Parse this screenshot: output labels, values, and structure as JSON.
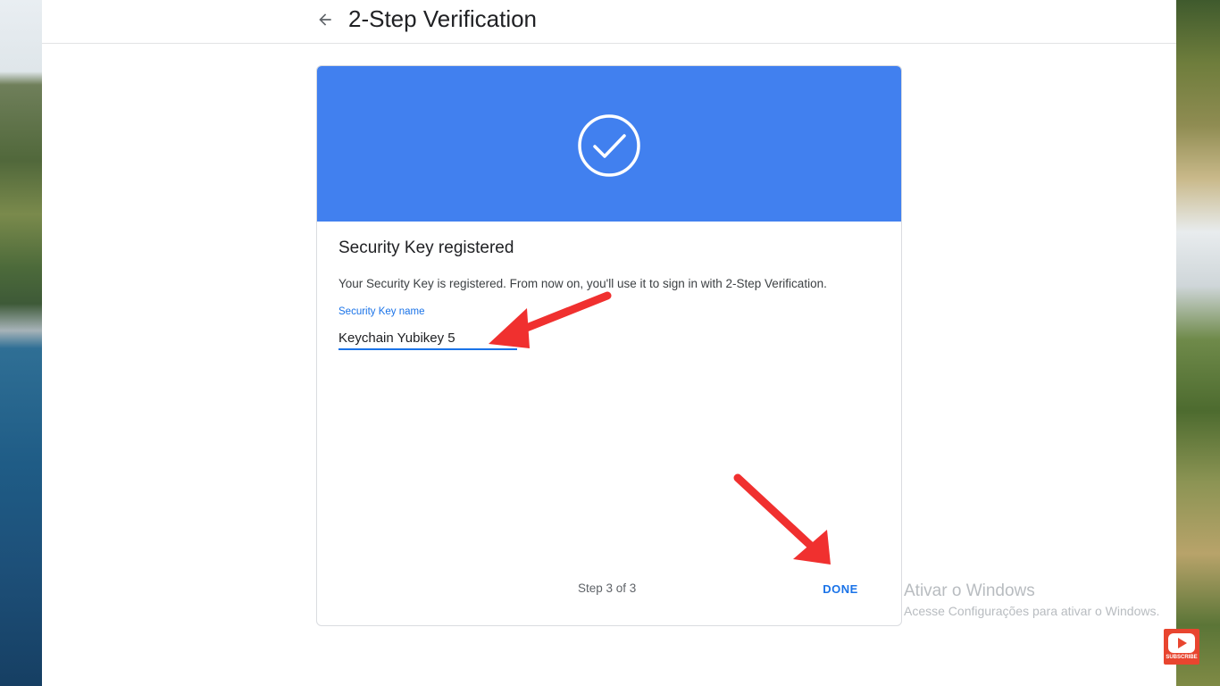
{
  "header": {
    "title": "2-Step Verification",
    "back_icon": "arrow-left-icon"
  },
  "card": {
    "hero_color": "#4180ef",
    "hero_icon": "check-circle-icon",
    "heading": "Security Key registered",
    "description": "Your Security Key is registered. From now on, you'll use it to sign in with 2-Step Verification.",
    "field_label": "Security Key name",
    "field_value": "Keychain Yubikey 5",
    "step_text": "Step 3 of 3",
    "done_label": "DONE"
  },
  "overlay": {
    "arrow_color": "#f0302f",
    "windows_title": "Ativar o Windows",
    "windows_subtitle": "Acesse Configurações para ativar o Windows.",
    "subscribe_label": "SUBSCRIBE"
  }
}
